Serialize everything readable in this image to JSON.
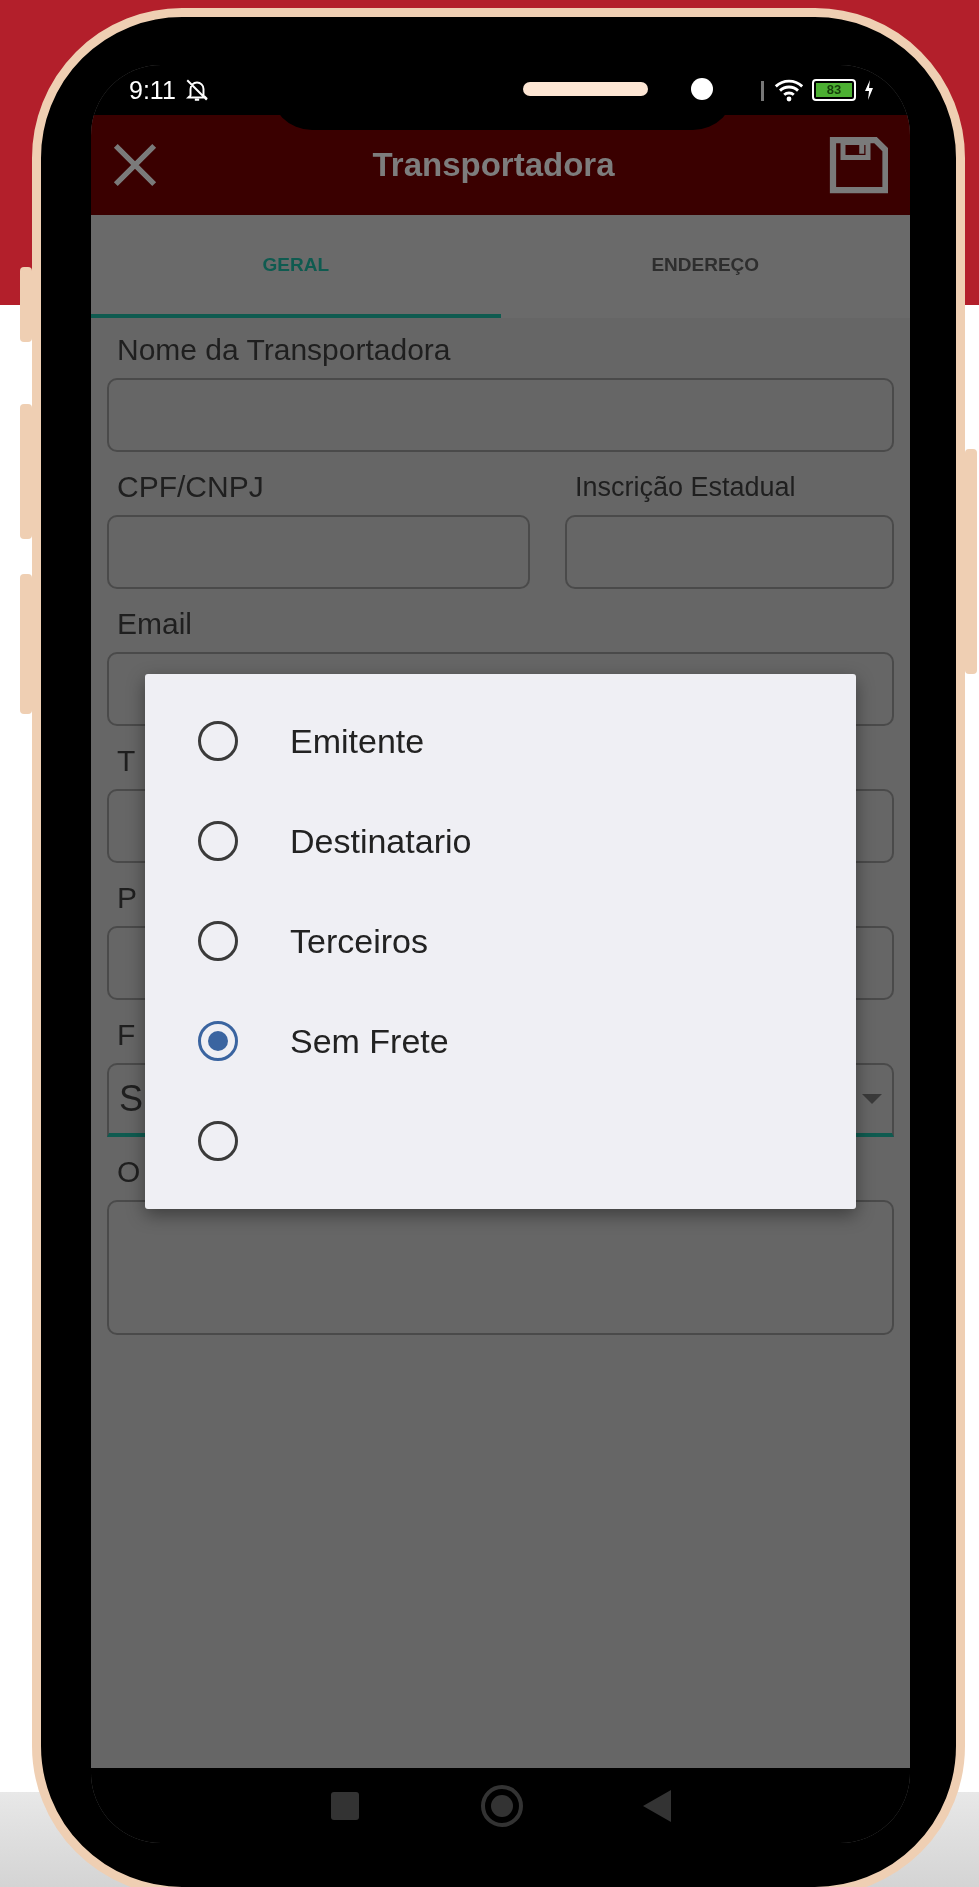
{
  "status_bar": {
    "time": "9:11",
    "battery": "83"
  },
  "app_bar": {
    "title": "Transportadora"
  },
  "tabs": [
    {
      "label": "GERAL",
      "selected": true
    },
    {
      "label": "ENDEREÇO",
      "selected": false
    }
  ],
  "form": {
    "rows": [
      [
        {
          "label": "Nome da Transportadora",
          "kind": "text"
        }
      ],
      [
        {
          "label": "CPF/CNPJ",
          "kind": "text"
        },
        {
          "label": "Inscrição Estadual",
          "kind": "text"
        }
      ],
      [
        {
          "label": "Email",
          "kind": "text"
        }
      ],
      [
        {
          "label": "T",
          "kind": "text"
        }
      ],
      [
        {
          "label": "P",
          "kind": "text"
        }
      ],
      [
        {
          "label": "F",
          "kind": "select",
          "value": "S"
        }
      ],
      [
        {
          "label": "O",
          "kind": "textarea"
        }
      ]
    ]
  },
  "dialog": {
    "options": [
      {
        "label": "Emitente",
        "selected": false
      },
      {
        "label": "Destinatario",
        "selected": false
      },
      {
        "label": "Terceiros",
        "selected": false
      },
      {
        "label": "Sem Frete",
        "selected": true
      },
      {
        "selected": false
      }
    ]
  }
}
